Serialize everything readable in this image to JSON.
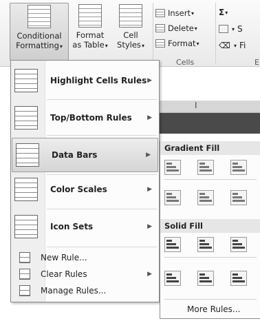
{
  "ribbon": {
    "conditional_label_1": "Conditional",
    "conditional_label_2": "Formatting",
    "format_table_label_1": "Format",
    "format_table_label_2": "as Table",
    "cell_styles_label_1": "Cell",
    "cell_styles_label_2": "Styles",
    "insert_label": "Insert",
    "delete_label": "Delete",
    "format_label": "Format",
    "cells_group_label": "Cells",
    "sigma": "Σ",
    "edit_partial_1": "S",
    "edit_partial_2": "Fi",
    "edit_group_partial": "E",
    "caret": "▾"
  },
  "sheet": {
    "column_i": "I"
  },
  "menu": {
    "items": [
      {
        "label": "Highlight Cells Rules",
        "icon": "highlight-cells-icon",
        "has_submenu": true
      },
      {
        "label": "Top/Bottom Rules",
        "icon": "top-bottom-icon",
        "has_submenu": true
      },
      {
        "label": "Data Bars",
        "icon": "data-bars-icon",
        "has_submenu": true,
        "active": true
      },
      {
        "label": "Color Scales",
        "icon": "color-scales-icon",
        "has_submenu": true
      },
      {
        "label": "Icon Sets",
        "icon": "icon-sets-icon",
        "has_submenu": true
      }
    ],
    "small_items": [
      {
        "label": "New Rule...",
        "icon": "new-rule-icon"
      },
      {
        "label": "Clear Rules",
        "icon": "clear-rules-icon",
        "has_submenu": true
      },
      {
        "label": "Manage Rules...",
        "icon": "manage-rules-icon"
      }
    ],
    "arrow": "▶"
  },
  "submenu": {
    "gradient_fill_label": "Gradient Fill",
    "solid_fill_label": "Solid Fill",
    "more_rules_label": "More Rules..."
  }
}
